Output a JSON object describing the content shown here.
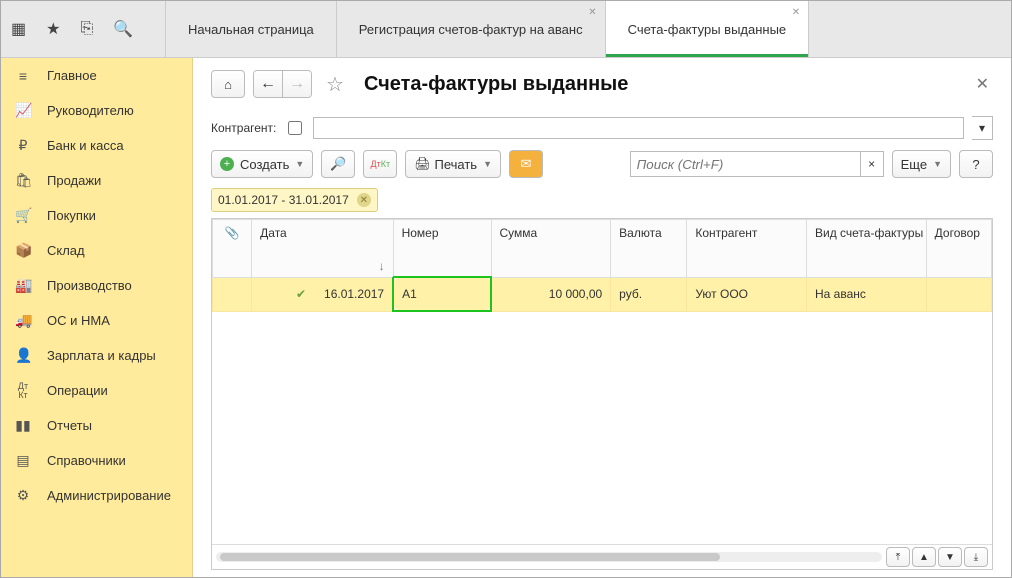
{
  "tabs": {
    "home": "Начальная страница",
    "reg": "Регистрация счетов-фактур на аванс",
    "active": "Счета-фактуры выданные"
  },
  "sidebar": [
    "Главное",
    "Руководителю",
    "Банк и касса",
    "Продажи",
    "Покупки",
    "Склад",
    "Производство",
    "ОС и НМА",
    "Зарплата и кадры",
    "Операции",
    "Отчеты",
    "Справочники",
    "Администрирование"
  ],
  "page": {
    "title": "Счета-фактуры выданные",
    "filter_label": "Контрагент:"
  },
  "toolbar": {
    "create": "Создать",
    "print": "Печать",
    "more": "Еще",
    "help": "?",
    "search_placeholder": "Поиск (Ctrl+F)"
  },
  "date_chip": "01.01.2017 - 31.01.2017",
  "columns": {
    "date": "Дата",
    "number": "Номер",
    "sum": "Сумма",
    "currency": "Валюта",
    "counterparty": "Контрагент",
    "type": "Вид счета-фактуры",
    "contract": "Договор"
  },
  "row": {
    "date": "16.01.2017",
    "number": "А1",
    "sum": "10 000,00",
    "currency": "руб.",
    "counterparty": "Уют ООО",
    "type": "На аванс",
    "contract": ""
  }
}
